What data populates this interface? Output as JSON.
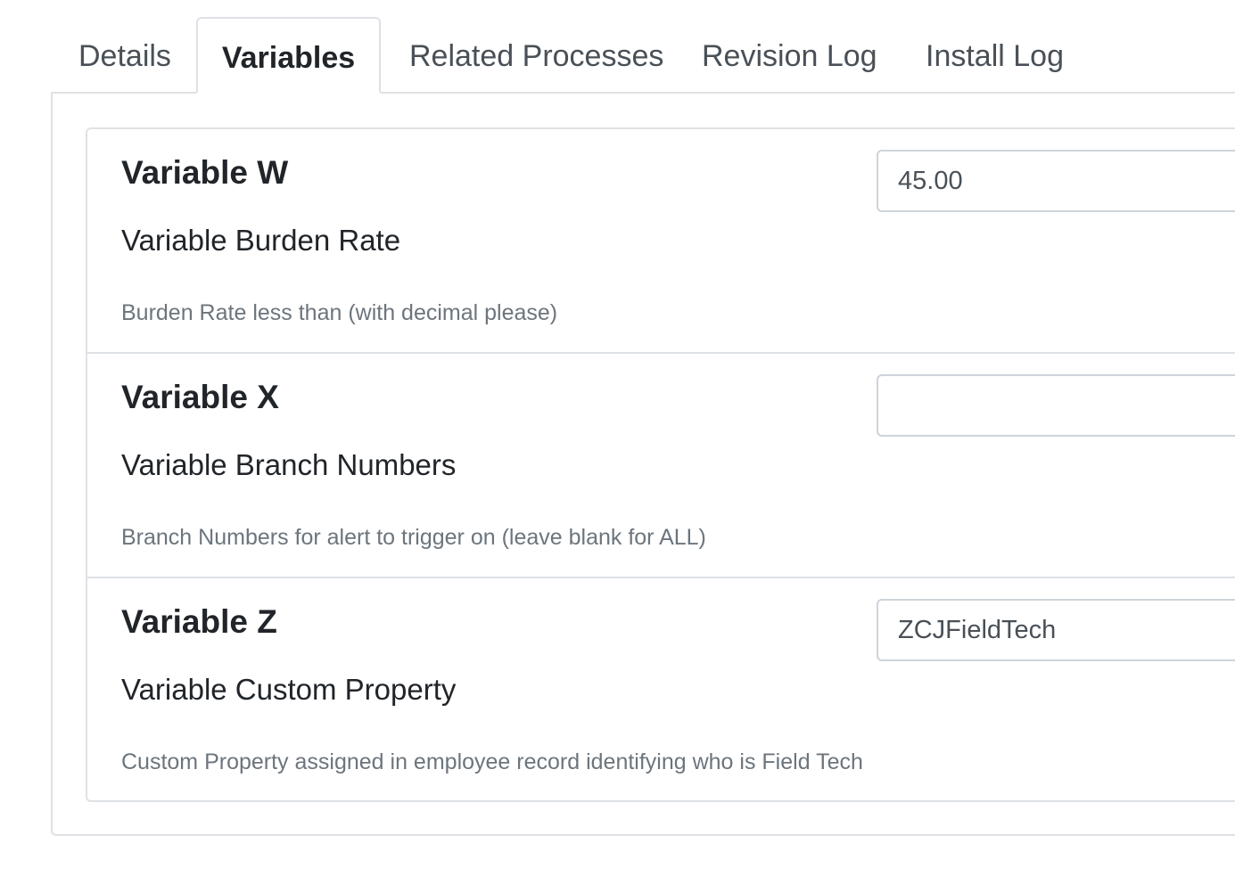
{
  "tabs": [
    {
      "label": "Details",
      "active": false
    },
    {
      "label": "Variables",
      "active": true
    },
    {
      "label": "Related Processes",
      "active": false
    },
    {
      "label": "Revision Log",
      "active": false
    },
    {
      "label": "Install Log",
      "active": false
    }
  ],
  "variables": [
    {
      "name": "Variable W",
      "label": "Variable Burden Rate",
      "help": "Burden Rate less than (with decimal please)",
      "value": "45.00"
    },
    {
      "name": "Variable X",
      "label": "Variable Branch Numbers",
      "help": "Branch Numbers for alert to trigger on (leave blank for ALL)",
      "value": ""
    },
    {
      "name": "Variable Z",
      "label": "Variable Custom Property",
      "help": "Custom Property assigned in employee record identifying who is Field Tech",
      "value": "ZCJFieldTech"
    }
  ]
}
